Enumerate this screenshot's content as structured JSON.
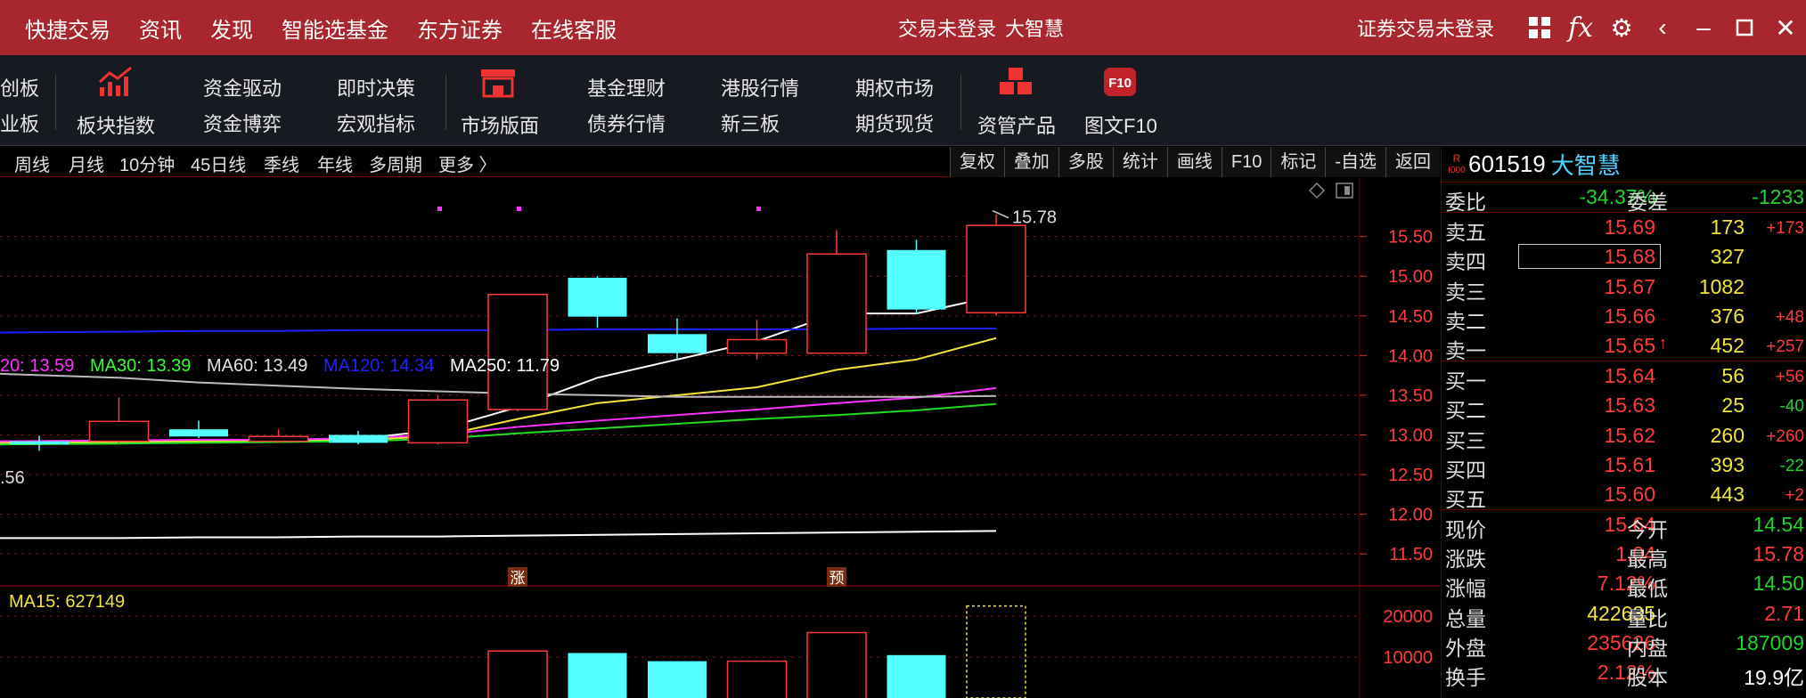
{
  "titlebar": {
    "menu": [
      "快捷交易",
      "资讯",
      "发现",
      "智能选基金",
      "东方证券",
      "在线客服"
    ],
    "status": "交易未登录",
    "brand": "大智慧",
    "login_status": "证券交易未登录",
    "icons": [
      "grid-icon",
      "fx-icon",
      "gear-icon",
      "back-icon",
      "minimize-icon",
      "maximize-icon",
      "close-icon"
    ]
  },
  "toolbar": {
    "col0_top": "创板",
    "col0_bottom": "业板",
    "bankuai": "板块指数",
    "col_a_top": "资金驱动",
    "col_a_bottom": "资金博弈",
    "col_b_top": "即时决策",
    "col_b_bottom": "宏观指标",
    "market": "市场版面",
    "col_c_top": "基金理财",
    "col_c_bottom": "债券行情",
    "col_d_top": "港股行情",
    "col_d_bottom": "新三板",
    "col_e_top": "期权市场",
    "col_e_bottom": "期货现货",
    "asset": "资管产品",
    "f10": "图文F10",
    "f10_icon_text": "F10"
  },
  "tabs": [
    "周线",
    "月线",
    "10分钟",
    "45日线",
    "季线",
    "年线",
    "多周期",
    "更多 〉"
  ],
  "right_buttons": [
    "复权",
    "叠加",
    "多股",
    "统计",
    "画线",
    "F10",
    "标记",
    "-自选",
    "返回"
  ],
  "ma_legend": [
    {
      "text": "20: 13.59",
      "color": "#ff33ff"
    },
    {
      "text": "MA30: 13.39",
      "color": "#33ff33"
    },
    {
      "text": "MA60: 13.49",
      "color": "#e0e0e0"
    },
    {
      "text": "MA120: 14.34",
      "color": "#2222ff"
    },
    {
      "text": "MA250: 11.79",
      "color": "#ffffff"
    }
  ],
  "price_axis": [
    "15.50",
    "15.00",
    "14.50",
    "14.00",
    "13.50",
    "13.00",
    "12.50",
    "12.00",
    "11.50"
  ],
  "vol_axis": [
    "20000",
    "10000"
  ],
  "chart_labels": {
    "high_marker": "15.78",
    "low_marker": ".56",
    "tag_zhang": "涨",
    "tag_yu": "预",
    "ma15": "MA15: 627149"
  },
  "quote": {
    "code": "601519",
    "name": "大智慧",
    "badge": "R",
    "badge2": "I000",
    "weibi_label": "委比",
    "weibi": "-34.37%",
    "weicha_label": "委差",
    "weicha": "-1233",
    "asks": [
      {
        "label": "卖五",
        "price": "15.69",
        "vol": "173",
        "chg": "+173"
      },
      {
        "label": "卖四",
        "price": "15.68",
        "vol": "327",
        "chg": ""
      },
      {
        "label": "卖三",
        "price": "15.67",
        "vol": "1082",
        "chg": ""
      },
      {
        "label": "卖二",
        "price": "15.66",
        "vol": "376",
        "chg": "+48"
      },
      {
        "label": "卖一",
        "price": "15.65",
        "vol": "452",
        "chg": "+257"
      }
    ],
    "bids": [
      {
        "label": "买一",
        "price": "15.64",
        "vol": "56",
        "chg": "+56"
      },
      {
        "label": "买二",
        "price": "15.63",
        "vol": "25",
        "chg": "-40"
      },
      {
        "label": "买三",
        "price": "15.62",
        "vol": "260",
        "chg": "+260"
      },
      {
        "label": "买四",
        "price": "15.61",
        "vol": "393",
        "chg": "-22"
      },
      {
        "label": "买五",
        "price": "15.60",
        "vol": "443",
        "chg": "+2"
      }
    ],
    "stats": [
      {
        "l1": "现价",
        "v1": "15.64",
        "l2": "今开",
        "v2": "14.54"
      },
      {
        "l1": "涨跌",
        "v1": "1.04",
        "l2": "最高",
        "v2": "15.78"
      },
      {
        "l1": "涨幅",
        "v1": "7.12%",
        "l2": "最低",
        "v2": "14.50"
      },
      {
        "l1": "总量",
        "v1": "422635",
        "l2": "量比",
        "v2": "2.71"
      },
      {
        "l1": "外盘",
        "v1": "235626",
        "l2": "内盘",
        "v2": "187009"
      },
      {
        "l1": "换手",
        "v1": "2.12%",
        "l2": "股本",
        "v2": "19.9亿"
      }
    ]
  },
  "chart_data": {
    "type": "candlestick",
    "y_range": [
      11.3,
      15.9
    ],
    "candles": [
      {
        "o": 12.92,
        "c": 12.88,
        "h": 12.99,
        "l": 12.8
      },
      {
        "o": 12.92,
        "c": 13.17,
        "h": 13.47,
        "l": 12.9
      },
      {
        "o": 13.07,
        "c": 12.98,
        "h": 13.18,
        "l": 12.96
      },
      {
        "o": 12.92,
        "c": 12.98,
        "h": 13.07,
        "l": 12.9
      },
      {
        "o": 13.0,
        "c": 12.9,
        "h": 13.05,
        "l": 12.88
      },
      {
        "o": 12.9,
        "c": 13.44,
        "h": 13.5,
        "l": 12.88
      },
      {
        "o": 13.32,
        "c": 14.77,
        "h": 14.77,
        "l": 13.3
      },
      {
        "o": 14.98,
        "c": 14.49,
        "h": 15.0,
        "l": 14.35
      },
      {
        "o": 14.27,
        "c": 14.03,
        "h": 14.47,
        "l": 13.95
      },
      {
        "o": 14.03,
        "c": 14.2,
        "h": 14.45,
        "l": 13.95
      },
      {
        "o": 14.03,
        "c": 15.28,
        "h": 15.58,
        "l": 14.03
      },
      {
        "o": 15.33,
        "c": 14.58,
        "h": 15.46,
        "l": 14.52
      },
      {
        "o": 14.54,
        "c": 15.64,
        "h": 15.78,
        "l": 14.5
      }
    ],
    "ma": {
      "white_fast": [
        12.88,
        12.9,
        12.92,
        12.93,
        12.95,
        13.06,
        13.35,
        13.72,
        13.95,
        14.18,
        14.53,
        14.53,
        14.75
      ],
      "yellow": [
        12.9,
        12.91,
        12.92,
        12.92,
        12.94,
        12.98,
        13.2,
        13.4,
        13.5,
        13.6,
        13.82,
        13.95,
        14.22
      ],
      "magenta": [
        12.92,
        12.93,
        12.94,
        12.94,
        12.96,
        13.0,
        13.1,
        13.18,
        13.25,
        13.32,
        13.4,
        13.47,
        13.59
      ],
      "green": [
        12.88,
        12.89,
        12.9,
        12.91,
        12.92,
        12.95,
        13.02,
        13.08,
        13.14,
        13.2,
        13.25,
        13.31,
        13.39
      ],
      "lightgray": [
        13.77,
        13.72,
        13.66,
        13.62,
        13.58,
        13.55,
        13.52,
        13.5,
        13.48,
        13.48,
        13.48,
        13.48,
        13.49
      ],
      "blue": [
        14.29,
        14.3,
        14.31,
        14.31,
        14.32,
        14.32,
        14.32,
        14.33,
        14.33,
        14.33,
        14.33,
        14.34,
        14.34
      ],
      "white_slow": [
        11.7,
        11.7,
        11.71,
        11.71,
        11.72,
        11.72,
        11.73,
        11.74,
        11.75,
        11.76,
        11.77,
        11.78,
        11.79
      ]
    },
    "volume_range": [
      0,
      27000
    ],
    "volumes": [
      {
        "v": 0,
        "up": true
      },
      {
        "v": 0,
        "up": true
      },
      {
        "v": 0,
        "up": false
      },
      {
        "v": 0,
        "up": true
      },
      {
        "v": 0,
        "up": false
      },
      {
        "v": 0,
        "up": true
      },
      {
        "v": 11500,
        "up": true
      },
      {
        "v": 11000,
        "up": false
      },
      {
        "v": 9000,
        "up": false
      },
      {
        "v": 9000,
        "up": true
      },
      {
        "v": 16000,
        "up": true
      },
      {
        "v": 10500,
        "up": false
      },
      {
        "v": 22500,
        "up": true,
        "forecast": true
      }
    ]
  }
}
